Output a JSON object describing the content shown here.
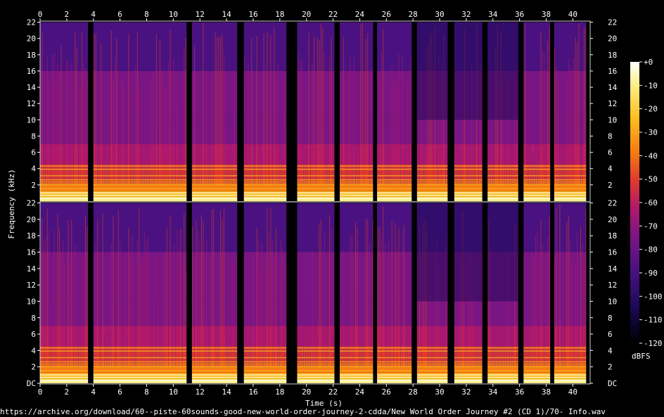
{
  "chart_data": {
    "type": "heatmap",
    "title": "",
    "xlabel": "Time (s)",
    "ylabel": "Frequency (kHz)",
    "xlim": [
      0,
      41.3
    ],
    "ylim": [
      0,
      22.05
    ],
    "x_ticks": [
      "0",
      "2",
      "4",
      "6",
      "8",
      "10",
      "12",
      "14",
      "16",
      "18",
      "20",
      "22",
      "24",
      "26",
      "28",
      "30",
      "32",
      "34",
      "36",
      "38",
      "40"
    ],
    "y_ticks_top": [
      "22",
      "20",
      "18",
      "16",
      "14",
      "12",
      "10",
      "8",
      "6",
      "4",
      "2"
    ],
    "y_ticks_bottom": [
      "22",
      "20",
      "18",
      "16",
      "14",
      "12",
      "10",
      "8",
      "6",
      "4",
      "2",
      "DC"
    ],
    "colorbar": {
      "label": "dBFS",
      "range": [
        -120,
        0
      ],
      "ticks": [
        "+0",
        "-10",
        "-20",
        "-30",
        "-40",
        "-50",
        "-60",
        "-70",
        "-80",
        "-90",
        "-100",
        "-110",
        "-120"
      ]
    },
    "channels": [
      "left",
      "right"
    ],
    "silent_gaps_s": [
      [
        3.6,
        4.0
      ],
      [
        11.0,
        11.4
      ],
      [
        14.8,
        15.3
      ],
      [
        18.5,
        19.3
      ],
      [
        22.1,
        22.5
      ],
      [
        25.0,
        25.3
      ],
      [
        27.9,
        28.3
      ],
      [
        30.6,
        31.1
      ],
      [
        33.2,
        33.6
      ],
      [
        35.9,
        36.3
      ],
      [
        38.3,
        38.6
      ]
    ],
    "colors": {
      "c0": "#000000",
      "c1": "#0a0428",
      "c2": "#200a5a",
      "c3": "#4a1280",
      "c4": "#7a1683",
      "c5": "#b0196c",
      "c6": "#e03a2c",
      "c7": "#f57c12",
      "c8": "#fbbe1e",
      "c9": "#fdf08a",
      "c10": "#ffffff"
    }
  },
  "footer": {
    "path": "https://archive.org/download/60--piste-60sounds-good-new-world-order-journey-2-cdda/New World Order Journey #2 (CD 1)/70- Info.wav"
  }
}
